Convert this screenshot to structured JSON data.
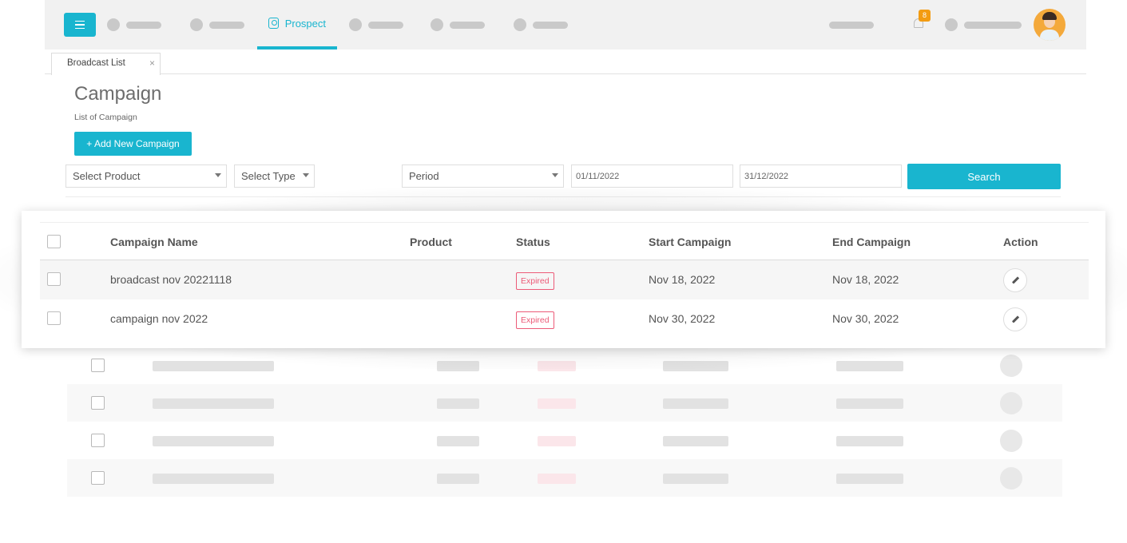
{
  "nav": {
    "active_label": "Prospect",
    "notification_count": "8"
  },
  "tabs": [
    {
      "label": "Broadcast List",
      "close": "×"
    }
  ],
  "header": {
    "title": "Campaign",
    "subtitle": "List of Campaign",
    "add_button": "+ Add New Campaign"
  },
  "filters": {
    "product": "Select Product",
    "type": "Select Type",
    "period": "Period",
    "start_date": "01/11/2022",
    "end_date": "31/12/2022",
    "search_label": "Search"
  },
  "table": {
    "columns": [
      "Campaign Name",
      "Product",
      "Status",
      "Start Campaign",
      "End Campaign",
      "Action"
    ],
    "rows": [
      {
        "name": "broadcast nov 20221118",
        "product": "",
        "status": "Expired",
        "start": "Nov 18, 2022",
        "end": "Nov 18, 2022"
      },
      {
        "name": "campaign nov 2022",
        "product": "",
        "status": "Expired",
        "start": "Nov 30, 2022",
        "end": "Nov 30, 2022"
      }
    ]
  },
  "colors": {
    "accent": "#19b5cf",
    "status_expired": "#ec5b78",
    "badge": "#f39c12"
  },
  "icons": [
    "menu-icon",
    "prospect-icon",
    "bell-icon",
    "close-icon",
    "caret-down-icon",
    "plus-icon",
    "edit-pencil-icon"
  ]
}
